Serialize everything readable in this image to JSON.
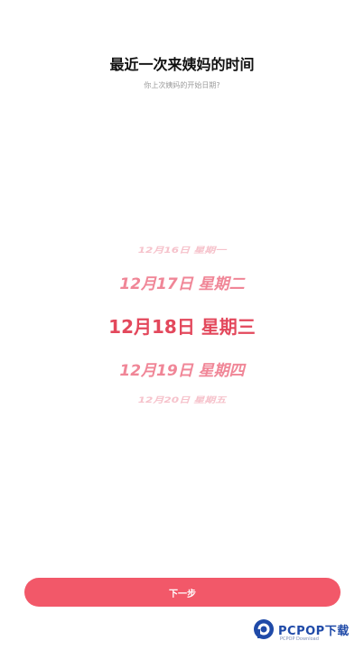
{
  "header": {
    "title": "最近一次来姨妈的时间",
    "subtitle": "你上次姨妈的开始日期?"
  },
  "picker": {
    "options": [
      "12月16日  星期一",
      "12月17日  星期二",
      "12月18日  星期三",
      "12月19日  星期四",
      "12月20日  星期五"
    ],
    "selected_index": 2
  },
  "footer": {
    "next_label": "下一步"
  },
  "watermark": {
    "brand": "PCPOP",
    "brand_suffix": "下载",
    "sub": "PCPOP Download"
  },
  "colors": {
    "accent": "#f25869",
    "selected_text": "#e3485c",
    "faded_text": "#f6c2cb"
  }
}
